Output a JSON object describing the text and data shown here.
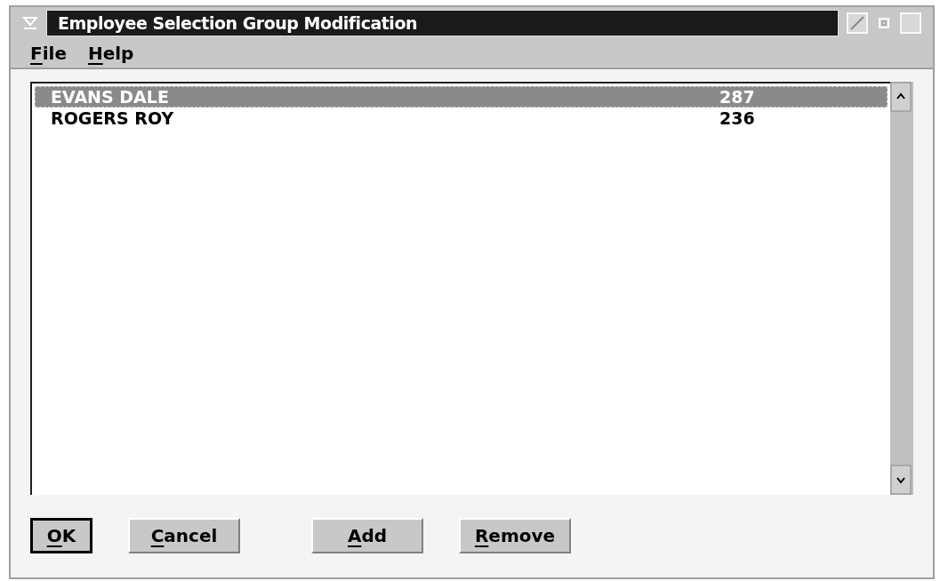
{
  "window": {
    "title": "Employee Selection Group Modification"
  },
  "menu": [
    {
      "label": "File"
    },
    {
      "label": "Help"
    }
  ],
  "list": {
    "rows": [
      {
        "name": "EVANS DALE",
        "number": "287",
        "selected": true
      },
      {
        "name": "ROGERS ROY",
        "number": "236",
        "selected": false
      }
    ]
  },
  "buttons": [
    {
      "label": "OK",
      "default": true
    },
    {
      "label": "Cancel",
      "default": false
    },
    {
      "label": "Add",
      "default": false
    },
    {
      "label": "Remove",
      "default": false
    }
  ]
}
